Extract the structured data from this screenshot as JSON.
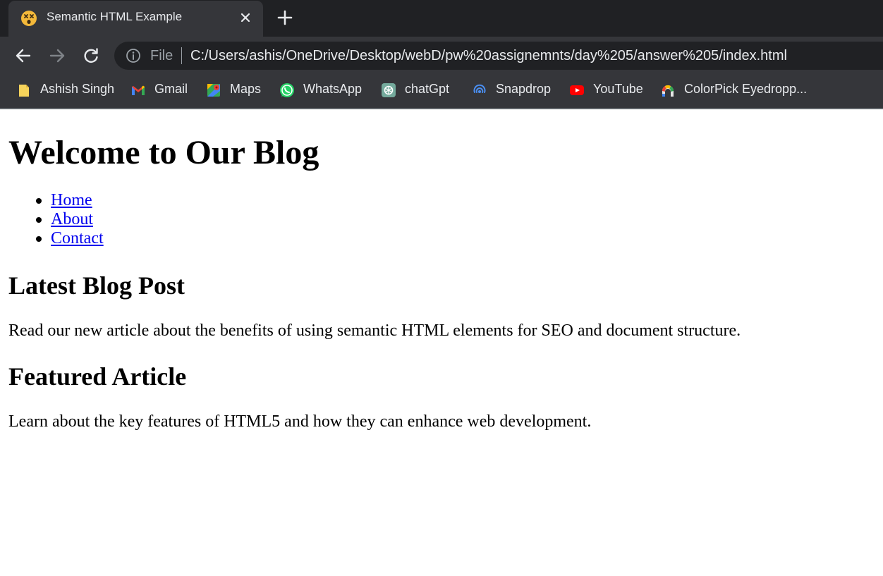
{
  "browser": {
    "tab": {
      "title": "Semantic HTML Example",
      "favicon": "dizzy-face-emoji-icon"
    },
    "address_bar": {
      "scheme_label": "File",
      "url": "C:/Users/ashis/OneDrive/Desktop/webD/pw%20assignemnts/day%205/answer%205/index.html"
    },
    "bookmarks": [
      {
        "label": "Ashish Singh",
        "icon": "folder-icon"
      },
      {
        "label": "Gmail",
        "icon": "gmail-icon"
      },
      {
        "label": "Maps",
        "icon": "maps-icon"
      },
      {
        "label": "WhatsApp",
        "icon": "whatsapp-icon"
      },
      {
        "label": "chatGpt",
        "icon": "chatgpt-icon"
      },
      {
        "label": "Snapdrop",
        "icon": "snapdrop-icon"
      },
      {
        "label": "YouTube",
        "icon": "youtube-icon"
      },
      {
        "label": "ColorPick Eyedropp...",
        "icon": "colorpick-icon"
      }
    ],
    "colors": {
      "tab_strip": "#202124",
      "toolbar": "#35363a",
      "omnibox": "#202124",
      "text": "#e8eaed",
      "link": "#0000ee"
    }
  },
  "page": {
    "heading": "Welcome to Our Blog",
    "nav": [
      {
        "label": "Home"
      },
      {
        "label": "About"
      },
      {
        "label": "Contact"
      }
    ],
    "sections": [
      {
        "heading": "Latest Blog Post",
        "text": "Read our new article about the benefits of using semantic HTML elements for SEO and document structure."
      },
      {
        "heading": "Featured Article",
        "text": "Learn about the key features of HTML5 and how they can enhance web development."
      }
    ]
  }
}
